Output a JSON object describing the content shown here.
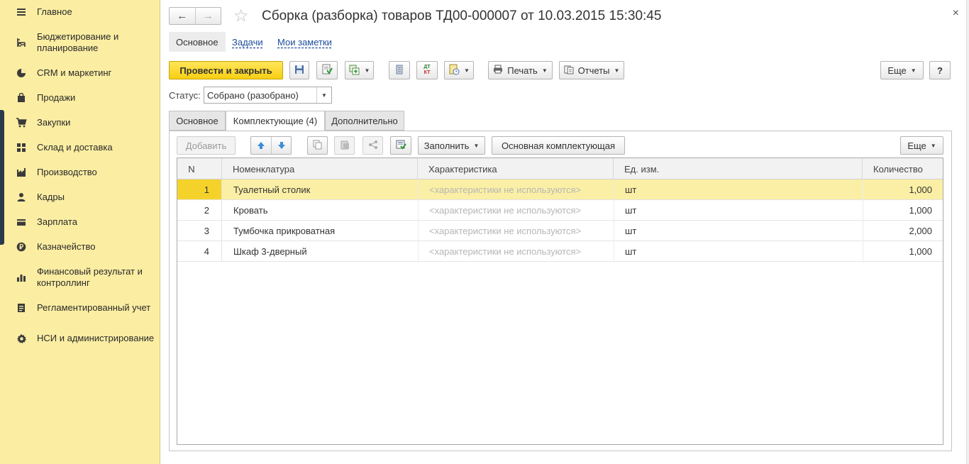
{
  "sidebar": {
    "items": [
      {
        "label": "Главное",
        "icon": "menu-icon"
      },
      {
        "label": "Бюджетирование и планирование",
        "icon": "budget-icon"
      },
      {
        "label": "CRM и маркетинг",
        "icon": "crm-icon"
      },
      {
        "label": "Продажи",
        "icon": "sales-bag-icon"
      },
      {
        "label": "Закупки",
        "icon": "cart-icon"
      },
      {
        "label": "Склад и доставка",
        "icon": "warehouse-icon"
      },
      {
        "label": "Производство",
        "icon": "factory-icon"
      },
      {
        "label": "Кадры",
        "icon": "person-icon"
      },
      {
        "label": "Зарплата",
        "icon": "wallet-icon"
      },
      {
        "label": "Казначейство",
        "icon": "ruble-icon"
      },
      {
        "label": "Финансовый результат и контроллинг",
        "icon": "bar-chart-icon"
      },
      {
        "label": "Регламентированный учет",
        "icon": "ledger-icon"
      },
      {
        "label": "НСИ и администрирование",
        "icon": "gear-icon"
      }
    ]
  },
  "header": {
    "back": "←",
    "forward": "→",
    "star": "☆",
    "title": "Сборка (разборка) товаров ТД00-000007 от 10.03.2015 15:30:45",
    "close": "×"
  },
  "top_tabs": {
    "main": "Основное",
    "tasks": "Задачи",
    "notes": "Мои заметки"
  },
  "toolbar": {
    "post_close": "Провести и закрыть",
    "print": "Печать",
    "reports": "Отчеты",
    "more": "Еще",
    "help": "?",
    "dt_kt_top": "ДТ",
    "dt_kt_bottom": "КТ"
  },
  "status": {
    "label": "Статус:",
    "value": "Собрано (разобрано)"
  },
  "form_tabs": {
    "main": "Основное",
    "components": "Комплектующие (4)",
    "extra": "Дополнительно"
  },
  "table_toolbar": {
    "add": "Добавить",
    "fill": "Заполнить",
    "main_component": "Основная комплектующая",
    "more": "Еще"
  },
  "table": {
    "columns": {
      "n": "N",
      "item": "Номенклатура",
      "characteristic": "Характеристика",
      "unit": "Ед. изм.",
      "qty": "Количество"
    },
    "rows": [
      {
        "n": "1",
        "item": "Туалетный столик",
        "characteristic": "<характеристики не используются>",
        "unit": "шт",
        "qty": "1,000"
      },
      {
        "n": "2",
        "item": "Кровать",
        "characteristic": "<характеристики не используются>",
        "unit": "шт",
        "qty": "1,000"
      },
      {
        "n": "3",
        "item": "Тумбочка прикроватная",
        "characteristic": "<характеристики не используются>",
        "unit": "шт",
        "qty": "2,000"
      },
      {
        "n": "4",
        "item": "Шкаф 3-дверный",
        "characteristic": "<характеристики не используются>",
        "unit": "шт",
        "qty": "1,000"
      }
    ]
  },
  "colors": {
    "sidebar_bg": "#fbeda2",
    "primary_button": "#f7cf12",
    "selected_row": "#fbefa5",
    "link": "#1a4c9c"
  }
}
